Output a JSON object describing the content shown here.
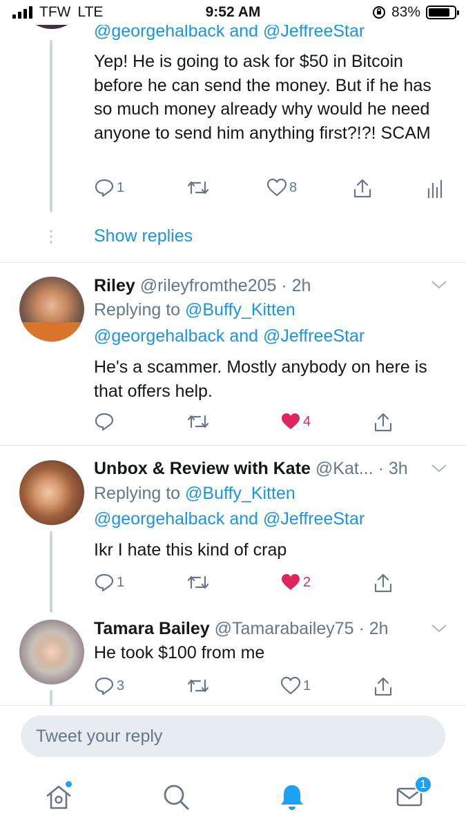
{
  "status": {
    "carrier": "TFW",
    "network": "LTE",
    "time": "9:52 AM",
    "battery": "83%",
    "battery_level": 0.83
  },
  "tweets": [
    {
      "mentions_end": "@georgehalback and @JeffreeStar",
      "text": "Yep! He is going to ask for $50 in Bitcoin before he can send the money. But if he has so much money already why would he need anyone to send him anything first?!?! SCAM",
      "reply_count": "1",
      "like_count": "8"
    },
    {
      "name": "Riley",
      "handle": "@rileyfromthe205 · 2h",
      "replying_prefix": "Replying to",
      "replying_to": "@Buffy_Kitten",
      "mentions": "@georgehalback and @JeffreeStar",
      "text": "He's a scammer. Mostly anybody on here is that offers help.",
      "like_count": "4"
    },
    {
      "name": "Unbox & Review with Kate",
      "handle": "@Kat... · 3h",
      "replying_prefix": "Replying to",
      "replying_to": "@Buffy_Kitten",
      "mentions": "@georgehalback and @JeffreeStar",
      "text": "Ikr I hate this kind of crap",
      "reply_count": "1",
      "like_count": "2"
    },
    {
      "name": "Tamara Bailey",
      "handle": "@Tamarabailey75 · 2h",
      "text": "He took $100 from me",
      "reply_count": "3",
      "like_count": "1"
    }
  ],
  "show_replies": "Show replies",
  "reply_box": {
    "placeholder": "Tweet your reply"
  },
  "tabs": [
    {
      "name": "home",
      "icon": "home-icon"
    },
    {
      "name": "search",
      "icon": "search-icon"
    },
    {
      "name": "notifications",
      "icon": "bell-icon"
    },
    {
      "name": "messages",
      "icon": "mail-icon",
      "badge": "1"
    }
  ],
  "colors": {
    "accent": "#1da1f2",
    "link": "#1b95e0",
    "like": "#e0245e",
    "secondary": "#657786"
  }
}
